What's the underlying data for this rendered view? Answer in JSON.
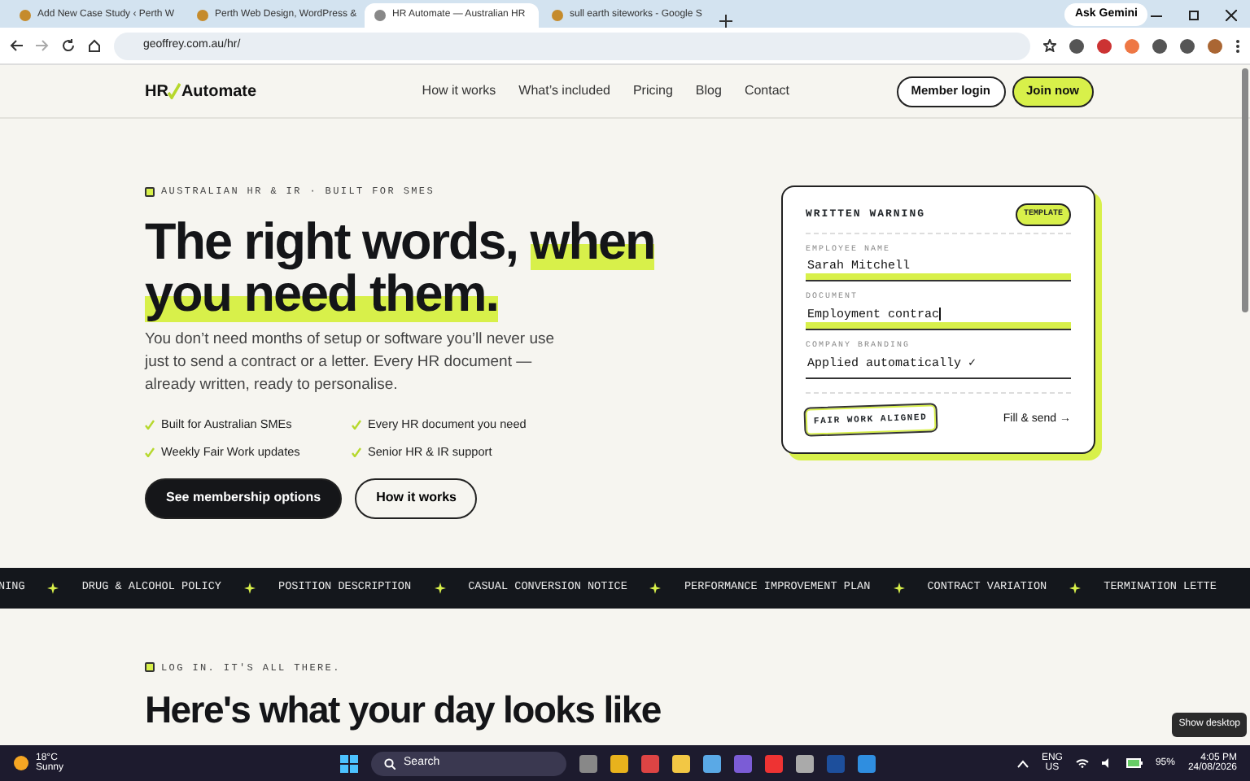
{
  "browser": {
    "tabs": [
      {
        "title": "Add New Case Study ‹ Perth W",
        "selected": false
      },
      {
        "title": "Perth Web Design, WordPress &",
        "selected": false
      },
      {
        "title": "HR Automate — Australian HR",
        "selected": true
      },
      {
        "title": "sull earth siteworks - Google S",
        "selected": false
      }
    ],
    "ask_gemini": "Ask Gemini",
    "url": "geoffrey.com.au/hr/"
  },
  "site": {
    "logo": {
      "left": "HR",
      "right": "Automate"
    },
    "nav": [
      "How it works",
      "What’s included",
      "Pricing",
      "Blog",
      "Contact"
    ],
    "buttons": [
      {
        "label": "Member login",
        "kind": "outline"
      },
      {
        "label": "Join now",
        "kind": "accent"
      }
    ]
  },
  "hero": {
    "eyebrow": "AUSTRALIAN HR & IR · BUILT FOR SMES",
    "headline": [
      {
        "text": "The right words,",
        "highlight": false
      },
      {
        "text": "when you need them.",
        "highlight": true
      }
    ],
    "intro": "You don’t need months of setup or software you’ll never use just to send a contract or a letter. Every HR document — already written, ready to personalise.",
    "features": [
      "Built for Australian SMEs",
      "Every HR document you need",
      "Weekly Fair Work updates",
      "Senior HR & IR support"
    ],
    "buttons": [
      {
        "label": "See membership options",
        "kind": "dark"
      },
      {
        "label": "How it works",
        "kind": "outline"
      }
    ]
  },
  "card": {
    "title": "WRITTEN WARNING",
    "badge": "TEMPLATE",
    "fields": [
      {
        "label": "EMPLOYEE NAME",
        "value": "Sarah Mitchell",
        "highlight": true,
        "cursor": false
      },
      {
        "label": "DOCUMENT",
        "value": "Employment contrac",
        "highlight": true,
        "cursor": true
      },
      {
        "label": "COMPANY BRANDING",
        "value": "Applied automatically ✓",
        "highlight": false,
        "cursor": false
      }
    ],
    "stamp": "FAIR WORK ALIGNED",
    "link": "Fill & send →"
  },
  "ticker": [
    "NING",
    "DRUG & ALCOHOL POLICY",
    "POSITION DESCRIPTION",
    "CASUAL CONVERSION NOTICE",
    "PERFORMANCE IMPROVEMENT PLAN",
    "CONTRACT VARIATION",
    "TERMINATION LETTE"
  ],
  "section": {
    "eyebrow": "LOG IN. IT'S ALL THERE.",
    "heading": "Here's what your day looks like"
  },
  "tooltip": "Show desktop",
  "taskbar": {
    "temperature": "18°C",
    "weather": "Sunny",
    "search": "Search",
    "lang": "ENG",
    "region": "US",
    "battery": "95%",
    "time": "4:05 PM",
    "date": "24/08/2026"
  }
}
